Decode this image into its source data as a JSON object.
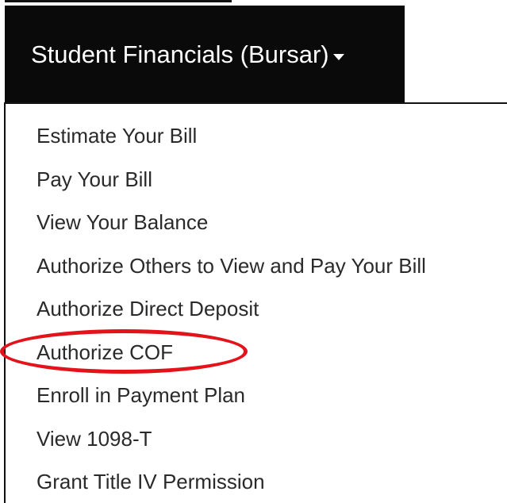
{
  "nav": {
    "menu_label": "Student Financials (Bursar)",
    "caret_icon": "caret-down-icon"
  },
  "dropdown": {
    "items": [
      {
        "label": "Estimate Your Bill"
      },
      {
        "label": "Pay Your Bill"
      },
      {
        "label": "View Your Balance"
      },
      {
        "label": "Authorize Others to View and Pay Your Bill"
      },
      {
        "label": "Authorize Direct Deposit"
      },
      {
        "label": "Authorize COF"
      },
      {
        "label": "Enroll in Payment Plan"
      },
      {
        "label": "View 1098-T"
      },
      {
        "label": "Grant Title IV Permission"
      }
    ],
    "highlighted_item_index": 5,
    "highlight_color": "#e3121b"
  },
  "colors": {
    "nav_background": "#0a0a0a",
    "nav_text": "#ffffff",
    "menu_text": "#2a2a2a",
    "border": "#111111"
  }
}
